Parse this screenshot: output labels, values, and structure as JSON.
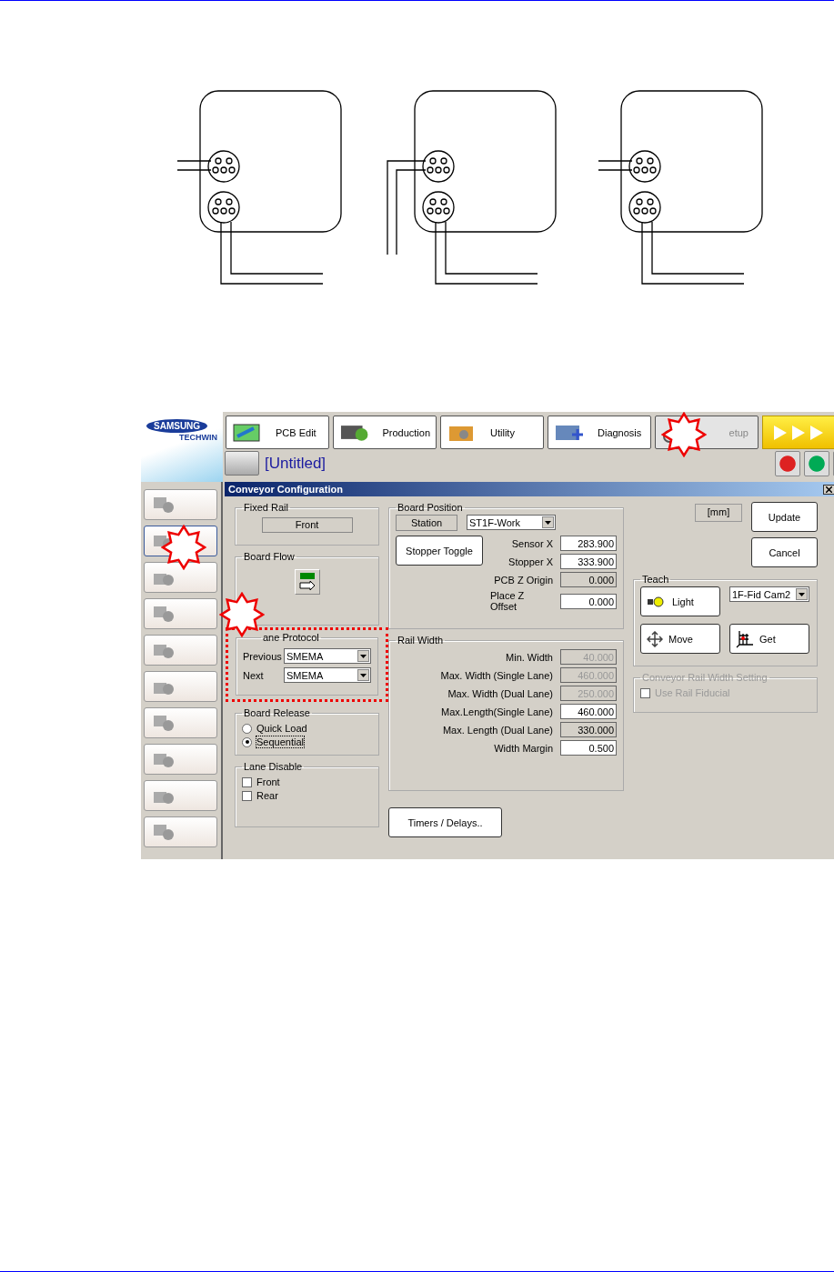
{
  "diagram": {
    "units": [
      {
        "kind": "straight"
      },
      {
        "kind": "bent"
      },
      {
        "kind": "straight"
      }
    ]
  },
  "logo": {
    "line_1": "SAMSUNG",
    "line_2": "TECHWIN"
  },
  "toolbar": {
    "tabs": [
      {
        "label": "PCB Edit",
        "disabled": false
      },
      {
        "label": "Production",
        "disabled": false
      },
      {
        "label": "Utility",
        "disabled": false
      },
      {
        "label": "Diagnosis",
        "disabled": false
      },
      {
        "label": "etup",
        "disabled": true
      }
    ]
  },
  "document": {
    "title": "[Untitled]"
  },
  "sidebar": {
    "items": [
      {
        "selected": false
      },
      {
        "selected": true
      },
      {
        "selected": false
      },
      {
        "selected": false
      },
      {
        "selected": false
      },
      {
        "selected": false
      },
      {
        "selected": false
      },
      {
        "selected": false
      },
      {
        "selected": false
      },
      {
        "selected": false
      }
    ]
  },
  "dialog": {
    "title": "Conveyor Configuration",
    "fixed_rail": {
      "title": "Fixed Rail",
      "value": "Front"
    },
    "board_flow": {
      "title": "Board Flow"
    },
    "lane_protocol": {
      "title": "ane Protocol",
      "rows": [
        {
          "label": "Previous",
          "value": "SMEMA"
        },
        {
          "label": "Next",
          "value": "SMEMA"
        }
      ]
    },
    "board_release": {
      "title": "Board Release",
      "options": [
        {
          "label": "Quick Load",
          "selected": false
        },
        {
          "label": "Sequential",
          "selected": true
        }
      ]
    },
    "lane_disable": {
      "title": "Lane Disable",
      "options": [
        {
          "label": "Front",
          "checked": false
        },
        {
          "label": "Rear",
          "checked": false
        }
      ]
    },
    "board_position": {
      "title": "Board Position",
      "station_label": "Station",
      "station": "ST1F-Work",
      "toggle_button": "Stopper Toggle",
      "fields": [
        {
          "label": "Sensor X",
          "value": "283.900",
          "read_only": false,
          "disabled": false
        },
        {
          "label": "Stopper X",
          "value": "333.900",
          "read_only": false,
          "disabled": false
        },
        {
          "label": "PCB Z Origin",
          "value": "0.000",
          "read_only": true,
          "disabled": false
        },
        {
          "label": "Place Z Offset",
          "value": "0.000",
          "read_only": false,
          "disabled": false
        }
      ]
    },
    "rail_width": {
      "title": "Rail Width",
      "fields": [
        {
          "label": "Min. Width",
          "value": "40.000",
          "read_only": true,
          "disabled": true
        },
        {
          "label": "Max. Width (Single Lane)",
          "value": "460.000",
          "read_only": true,
          "disabled": true
        },
        {
          "label": "Max. Width (Dual Lane)",
          "value": "250.000",
          "read_only": true,
          "disabled": true
        },
        {
          "label": "Max.Length(Single Lane)",
          "value": "460.000",
          "read_only": false,
          "disabled": false
        },
        {
          "label": "Max. Length (Dual Lane)",
          "value": "330.000",
          "read_only": true,
          "disabled": false
        },
        {
          "label": "Width Margin",
          "value": "0.500",
          "read_only": false,
          "disabled": false
        }
      ]
    },
    "timers_button": "Timers / Delays..",
    "unit": "[mm]",
    "update_button": "Update",
    "cancel_button": "Cancel",
    "teach": {
      "title": "Teach",
      "light_button": "Light",
      "camera": "1F-Fid Cam2",
      "move_button": "Move",
      "get_button": "Get"
    },
    "rail_setting": {
      "title": "Conveyor Rail Width Setting",
      "disabled": true,
      "option": {
        "label": "Use Rail Fiducial",
        "checked": false
      }
    }
  }
}
